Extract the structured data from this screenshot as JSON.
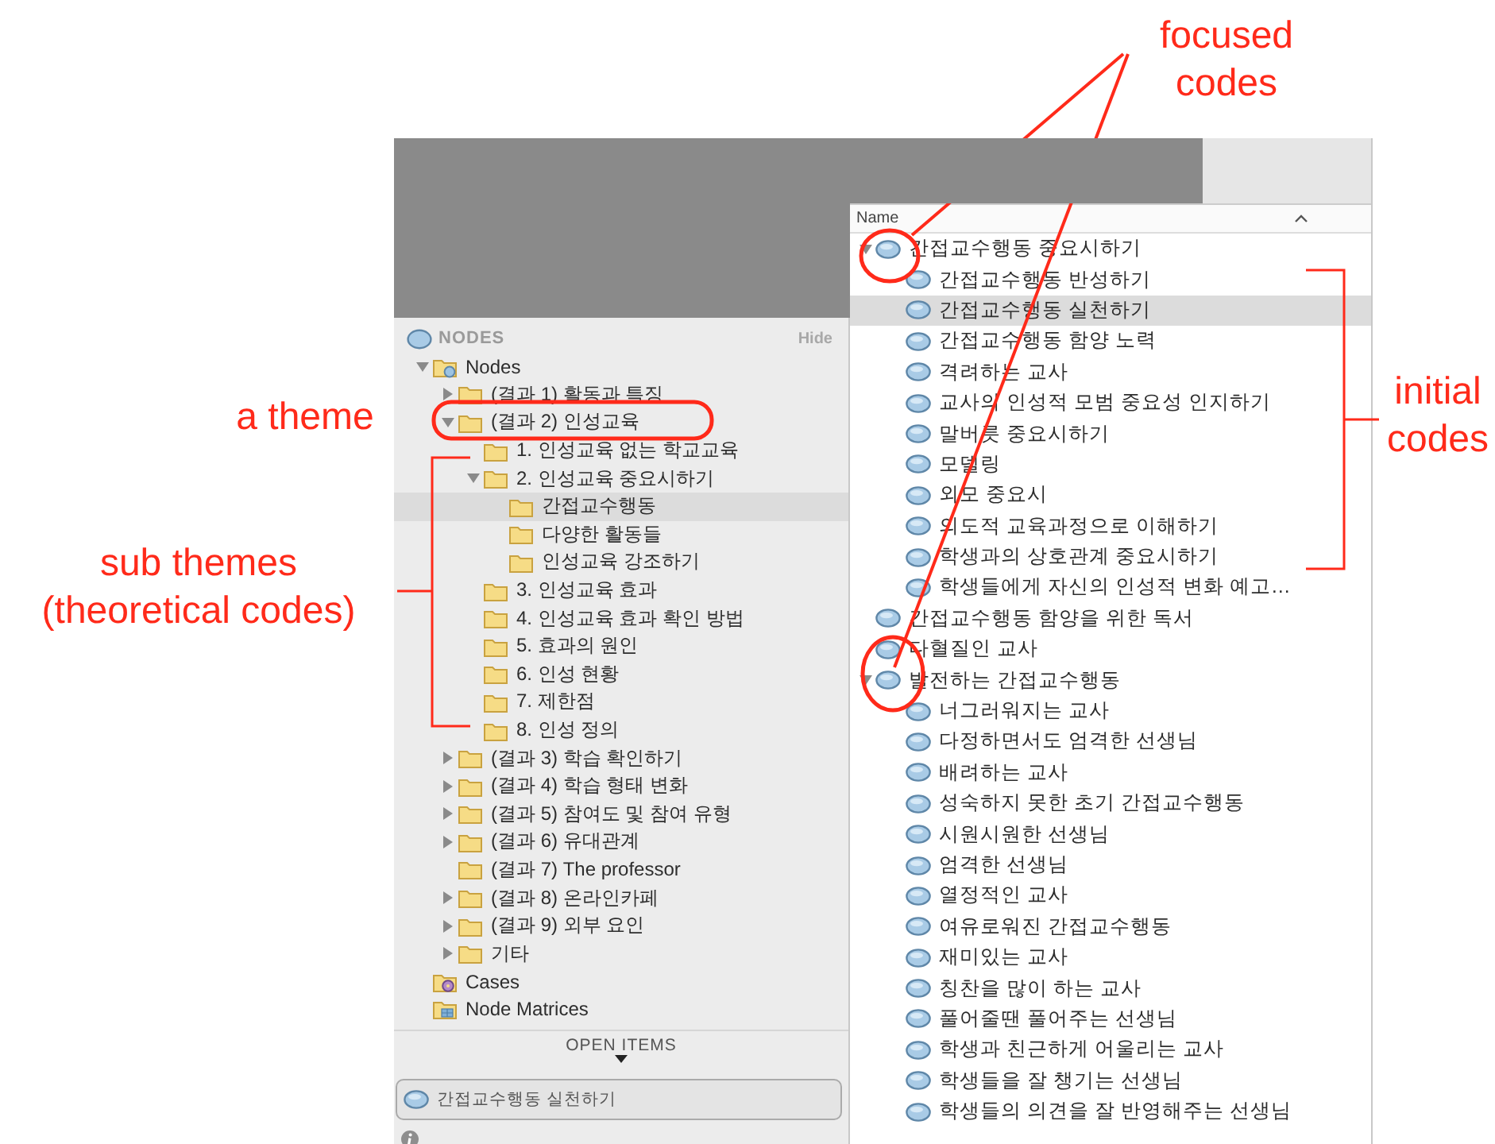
{
  "annotations": [
    {
      "text": "focused codes"
    },
    {
      "text": "a theme"
    },
    {
      "text": "sub themes (theoretical codes)"
    },
    {
      "text": "initial codes"
    }
  ],
  "nodes_panel": {
    "title": "NODES",
    "hide": "Hide",
    "tree": [
      {
        "kind": "nodes",
        "label": "Nodes",
        "expanded": true,
        "selected": false,
        "children": [
          {
            "kind": "folder",
            "label": "(결과 1) 활동과 특징",
            "expanded": false,
            "selected": false
          },
          {
            "kind": "folder",
            "label": "(결과 2) 인성교육",
            "expanded": true,
            "selected": false,
            "children": [
              {
                "kind": "folder",
                "label": "1. 인성교육 없는 학교교육",
                "selected": false
              },
              {
                "kind": "folder",
                "label": "2. 인성교육 중요시하기",
                "expanded": true,
                "selected": false,
                "children": [
                  {
                    "kind": "folder",
                    "label": "간접교수행동",
                    "selected": true
                  },
                  {
                    "kind": "folder",
                    "label": "다양한 활동들",
                    "selected": false
                  },
                  {
                    "kind": "folder",
                    "label": "인성교육 강조하기",
                    "selected": false
                  }
                ]
              },
              {
                "kind": "folder",
                "label": "3. 인성교육 효과",
                "selected": false
              },
              {
                "kind": "folder",
                "label": "4. 인성교육 효과 확인 방법",
                "selected": false
              },
              {
                "kind": "folder",
                "label": "5. 효과의 원인",
                "selected": false
              },
              {
                "kind": "folder",
                "label": "6. 인성 현황",
                "selected": false
              },
              {
                "kind": "folder",
                "label": "7. 제한점",
                "selected": false
              },
              {
                "kind": "folder",
                "label": "8. 인성 정의",
                "selected": false
              }
            ]
          },
          {
            "kind": "folder",
            "label": "(결과 3) 학습 확인하기",
            "expanded": false,
            "selected": false
          },
          {
            "kind": "folder",
            "label": "(결과 4) 학습 형태 변화",
            "expanded": false,
            "selected": false
          },
          {
            "kind": "folder",
            "label": "(결과 5) 참여도 및 참여 유형",
            "expanded": false,
            "selected": false
          },
          {
            "kind": "folder",
            "label": "(결과 6) 유대관계",
            "expanded": false,
            "selected": false
          },
          {
            "kind": "folder",
            "label": "(결과 7) The professor",
            "selected": false
          },
          {
            "kind": "folder",
            "label": "(결과 8) 온라인카페",
            "expanded": false,
            "selected": false
          },
          {
            "kind": "folder",
            "label": "(결과 9) 외부 요인",
            "expanded": false,
            "selected": false
          },
          {
            "kind": "folder",
            "label": "기타",
            "expanded": false,
            "selected": false
          }
        ]
      },
      {
        "kind": "cases",
        "label": "Cases",
        "selected": false
      },
      {
        "kind": "matrices",
        "label": "Node Matrices",
        "selected": false
      }
    ],
    "open_items": {
      "title": "OPEN ITEMS",
      "items": [
        {
          "label": "간접교수행동 실천하기"
        }
      ]
    }
  },
  "codes_panel": {
    "column": "Name",
    "tree": [
      {
        "label": "간접교수행동 중요시하기",
        "expanded": true,
        "selected": false,
        "children": [
          {
            "label": "간접교수행동 반성하기",
            "selected": false
          },
          {
            "label": "간접교수행동 실천하기",
            "selected": true
          },
          {
            "label": "간접교수행동 함양 노력",
            "selected": false
          },
          {
            "label": "격려하는 교사",
            "selected": false
          },
          {
            "label": "교사의 인성적 모범 중요성 인지하기",
            "selected": false
          },
          {
            "label": "말버릇 중요시하기",
            "selected": false
          },
          {
            "label": "모델링",
            "selected": false
          },
          {
            "label": "외모 중요시",
            "selected": false
          },
          {
            "label": "의도적 교육과정으로 이해하기",
            "selected": false
          },
          {
            "label": "학생과의 상호관계 중요시하기",
            "selected": false
          },
          {
            "label": "학생들에게 자신의 인성적 변화 예고…",
            "selected": false
          }
        ]
      },
      {
        "label": "간접교수행동 함양을 위한 독서",
        "selected": false
      },
      {
        "label": "다혈질인 교사",
        "selected": false
      },
      {
        "label": "발전하는 간접교수행동",
        "expanded": true,
        "selected": false,
        "children": [
          {
            "label": "너그러워지는 교사",
            "selected": false
          },
          {
            "label": "다정하면서도 엄격한 선생님",
            "selected": false
          },
          {
            "label": "배려하는 교사",
            "selected": false
          },
          {
            "label": "성숙하지 못한 초기 간접교수행동",
            "selected": false
          },
          {
            "label": "시원시원한 선생님",
            "selected": false
          },
          {
            "label": "엄격한 선생님",
            "selected": false
          },
          {
            "label": "열정적인 교사",
            "selected": false
          },
          {
            "label": "여유로워진 간접교수행동",
            "selected": false
          },
          {
            "label": "재미있는 교사",
            "selected": false
          },
          {
            "label": "칭찬을 많이 하는 교사",
            "selected": false
          },
          {
            "label": "풀어줄땐 풀어주는 선생님",
            "selected": false
          },
          {
            "label": "학생과 친근하게 어울리는 교사",
            "selected": false
          },
          {
            "label": "학생들을 잘 챙기는 선생님",
            "selected": false
          },
          {
            "label": "학생들의 의견을 잘 반영해주는 선생님",
            "selected": false
          }
        ]
      }
    ]
  }
}
